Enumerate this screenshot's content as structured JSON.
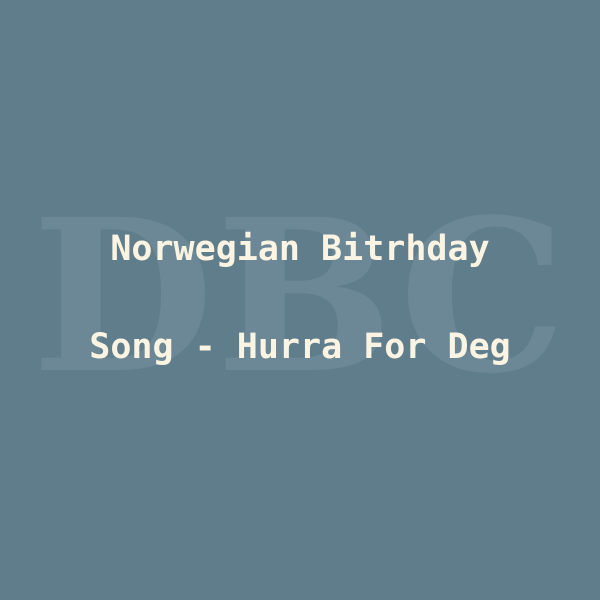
{
  "watermark": {
    "text": "DBC"
  },
  "title": {
    "line1": "Norwegian Bitrhday",
    "line2": "Song - Hurra For Deg"
  },
  "colors": {
    "background": "#607d8b",
    "watermark": "#6c8896",
    "text": "#fbf4e2"
  }
}
